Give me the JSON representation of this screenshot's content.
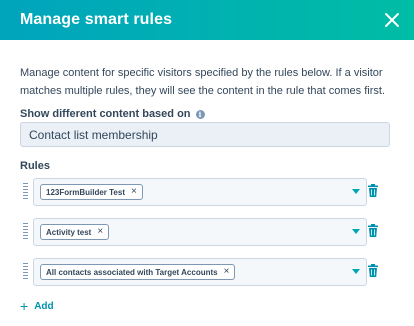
{
  "dialog": {
    "title": "Manage smart rules",
    "description": "Manage content for specific visitors specified by the rules below. If a visitor matches multiple rules, they will see the content in the rule that comes first."
  },
  "content_based_on": {
    "label": "Show different content based on",
    "value": "Contact list membership"
  },
  "rules": {
    "label": "Rules",
    "items": [
      {
        "tag": "123FormBuilder Test"
      },
      {
        "tag": "Activity test"
      },
      {
        "tag": "All contacts associated with Target Accounts"
      }
    ],
    "add_label": "Add"
  },
  "colors": {
    "header_gradient_start": "#00a4bd",
    "header_gradient_end": "#00bda5",
    "accent": "#0091ae",
    "text": "#33475b",
    "trash": "#0091ae"
  },
  "icons": [
    "close-icon",
    "info-icon",
    "drag-handle-icon",
    "remove-tag-icon",
    "chevron-down-icon",
    "trash-icon",
    "plus-icon"
  ]
}
